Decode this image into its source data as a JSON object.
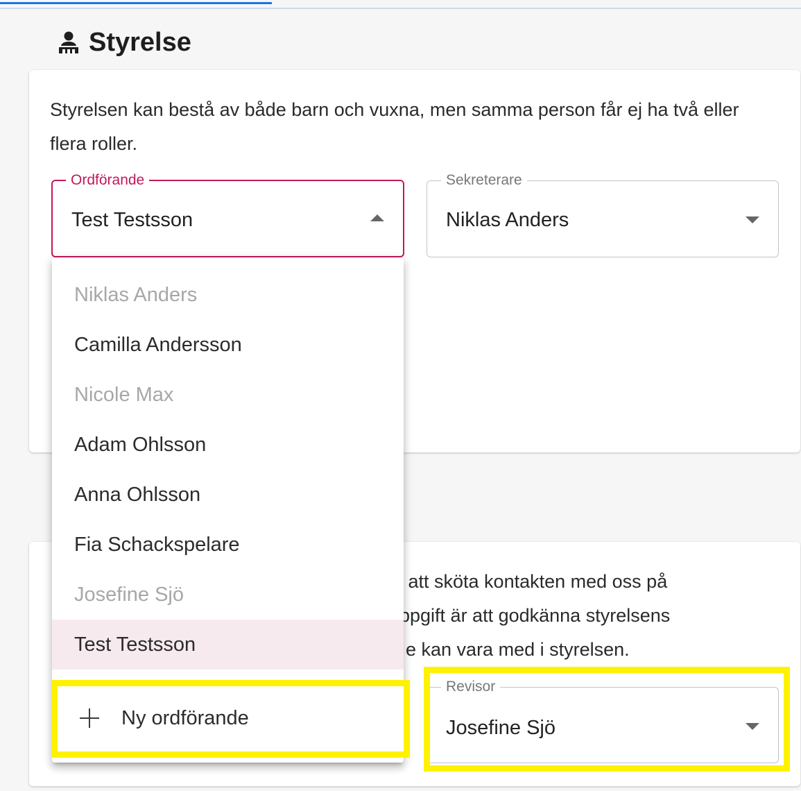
{
  "section": {
    "title": "Styrelse",
    "icon": "board-members-icon"
  },
  "card1": {
    "description": "Styrelsen kan bestå av både barn och vuxna, men samma person får ej ha två eller flera roller."
  },
  "fields": {
    "ordforande": {
      "label": "Ordförande",
      "value": "Test Testsson",
      "open": true
    },
    "sekreterare": {
      "label": "Sekreterare",
      "value": "Niklas Anders"
    },
    "revisor": {
      "label": "Revisor",
      "value": "Josefine Sjö"
    }
  },
  "dropdown": {
    "options": [
      {
        "label": "Niklas Anders",
        "disabled": true,
        "selected": false
      },
      {
        "label": "Camilla Andersson",
        "disabled": false,
        "selected": false
      },
      {
        "label": "Nicole Max",
        "disabled": true,
        "selected": false
      },
      {
        "label": "Adam Ohlsson",
        "disabled": false,
        "selected": false
      },
      {
        "label": "Anna Ohlsson",
        "disabled": false,
        "selected": false
      },
      {
        "label": "Fia Schackspelare",
        "disabled": false,
        "selected": false
      },
      {
        "label": "Josefine Sjö",
        "disabled": true,
        "selected": false
      },
      {
        "label": "Test Testsson",
        "disabled": false,
        "selected": true
      }
    ],
    "add_label": "Ny ordförande"
  },
  "card2": {
    "visible_text_fragments": [
      "r att sköta kontakten med oss på",
      "ppgift är att godkänna styrelsens",
      "e kan vara med i styrelsen."
    ]
  },
  "colors": {
    "accent": "#c2185b",
    "highlight": "#fff200",
    "selected_bg": "#f7eaef",
    "disabled_text": "#a7a7a7"
  }
}
